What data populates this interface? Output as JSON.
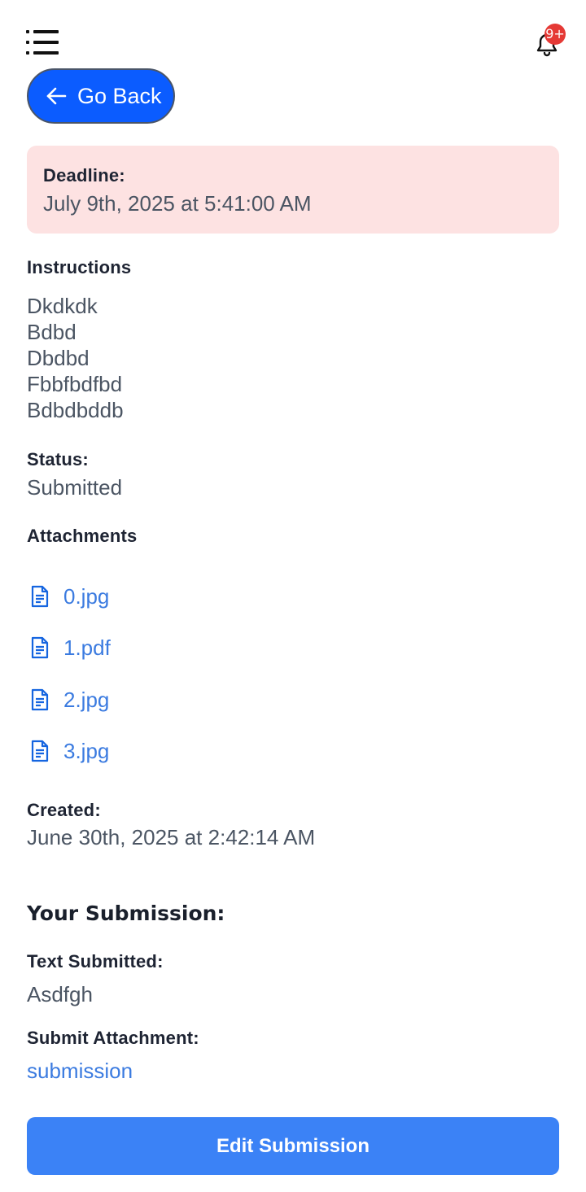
{
  "header": {
    "menu_icon": "menu-icon",
    "bell_icon": "bell-icon",
    "notification_badge": "9+"
  },
  "go_back": {
    "label": "Go Back",
    "icon": "arrow-left-icon"
  },
  "deadline": {
    "label": "Deadline:",
    "value": "July 9th, 2025 at 5:41:00 AM"
  },
  "instructions": {
    "label": "Instructions",
    "lines": [
      "Dkdkdk",
      "Bdbd",
      "Dbdbd",
      "Fbbfbdfbd",
      "Bdbdbddb"
    ]
  },
  "status": {
    "label": "Status:",
    "value": "Submitted"
  },
  "attachments": {
    "label": "Attachments",
    "items": [
      {
        "name": "0.jpg",
        "icon": "file-text-icon"
      },
      {
        "name": "1.pdf",
        "icon": "file-text-icon"
      },
      {
        "name": "2.jpg",
        "icon": "file-text-icon"
      },
      {
        "name": "3.jpg",
        "icon": "file-text-icon"
      }
    ]
  },
  "created": {
    "label": "Created:",
    "value": "June 30th, 2025 at 2:42:14 AM"
  },
  "submission": {
    "heading": "Your Submission:",
    "text_label": "Text Submitted:",
    "text_value": "Asdfgh",
    "attachment_label": "Submit Attachment:",
    "attachment_link": "submission"
  },
  "edit_button": {
    "label": "Edit Submission"
  },
  "colors": {
    "primary": "#0b5cff",
    "button": "#3b82f6",
    "link": "#3b7be0",
    "deadline_bg": "#fde2e2",
    "badge": "#e53935"
  }
}
